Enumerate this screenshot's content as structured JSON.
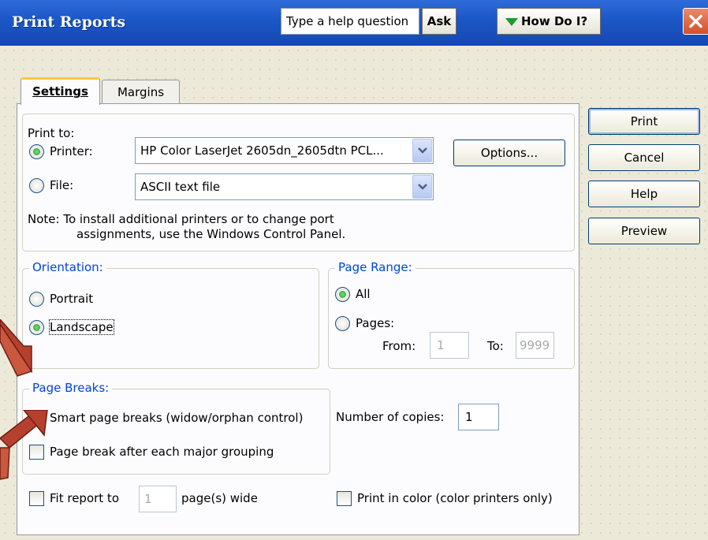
{
  "window": {
    "title": "Print Reports",
    "help_placeholder": "Type a help question",
    "ask_label": "Ask",
    "howdoi_label": "How Do I?"
  },
  "tabs": [
    {
      "label": "Settings",
      "selected": true
    },
    {
      "label": "Margins",
      "selected": false
    }
  ],
  "print_to": {
    "label": "Print to:",
    "printer_label": "Printer:",
    "printer_value": "HP Color LaserJet 2605dn_2605dtn PCL...",
    "file_label": "File:",
    "file_value": "ASCII text file",
    "selected": "printer",
    "options_label": "Options...",
    "note_line1": "Note: To install additional printers or to change port",
    "note_line2": "assignments, use the Windows Control Panel."
  },
  "orientation": {
    "legend": "Orientation:",
    "portrait_label": "Portrait",
    "landscape_label": "Landscape",
    "selected": "landscape"
  },
  "page_range": {
    "legend": "Page Range:",
    "all_label": "All",
    "pages_label": "Pages:",
    "from_label": "From:",
    "from_value": "1",
    "to_label": "To:",
    "to_value": "9999",
    "selected": "all"
  },
  "page_breaks": {
    "legend": "Page Breaks:",
    "smart_label": "Smart page breaks (widow/orphan control)",
    "smart_checked": true,
    "major_label": "Page break after each major grouping",
    "major_checked": false
  },
  "copies": {
    "label": "Number of copies:",
    "value": "1"
  },
  "fit": {
    "prefix": "Fit report to",
    "value": "1",
    "suffix": "page(s) wide",
    "checked": false
  },
  "color": {
    "label": "Print in color (color printers only)",
    "checked": false
  },
  "actions": {
    "print": "Print",
    "cancel": "Cancel",
    "help": "Help",
    "preview": "Preview"
  },
  "colors": {
    "titlebar": "#1c58c8",
    "legend": "#0046d5",
    "annotation_arrow": "#b5402e"
  }
}
